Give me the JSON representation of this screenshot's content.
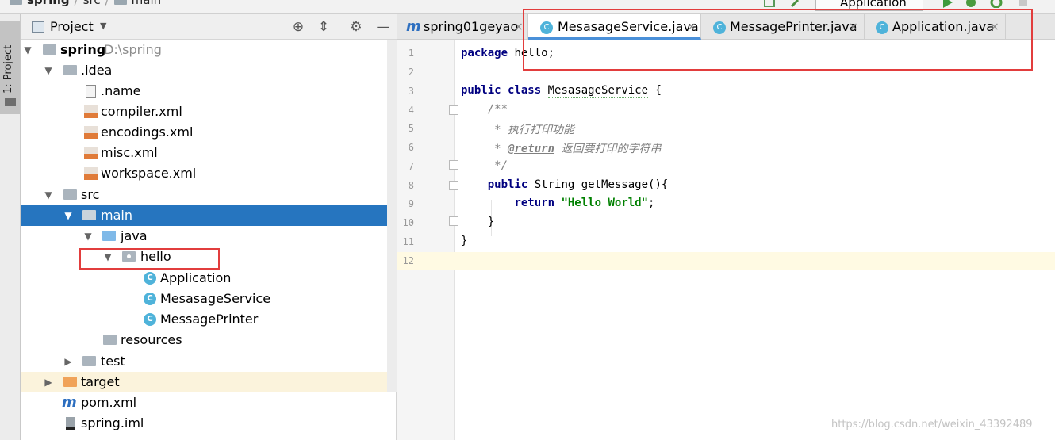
{
  "breadcrumb": {
    "root": "spring",
    "items": [
      "src",
      "main"
    ]
  },
  "toolbar": {
    "run_config": "Application"
  },
  "left_strip": {
    "label": "1: Project"
  },
  "project_panel": {
    "title": "Project",
    "tree": [
      {
        "label": "spring",
        "extra": "D:\\spring",
        "type": "folder"
      },
      {
        "label": ".idea",
        "type": "folder"
      },
      {
        "label": ".name",
        "type": "file"
      },
      {
        "label": "compiler.xml",
        "type": "xml"
      },
      {
        "label": "encodings.xml",
        "type": "xml"
      },
      {
        "label": "misc.xml",
        "type": "xml"
      },
      {
        "label": "workspace.xml",
        "type": "xml"
      },
      {
        "label": "src",
        "type": "folder"
      },
      {
        "label": "main",
        "type": "folder"
      },
      {
        "label": "java",
        "type": "folder"
      },
      {
        "label": "hello",
        "type": "package"
      },
      {
        "label": "Application",
        "type": "class"
      },
      {
        "label": "MesasageService",
        "type": "class"
      },
      {
        "label": "MessagePrinter",
        "type": "class"
      },
      {
        "label": "resources",
        "type": "folder"
      },
      {
        "label": "test",
        "type": "folder"
      },
      {
        "label": "target",
        "type": "folder"
      },
      {
        "label": "pom.xml",
        "type": "maven"
      },
      {
        "label": "spring.iml",
        "type": "iml"
      }
    ]
  },
  "editor": {
    "tabs": [
      {
        "label": "spring01geyao",
        "active": false
      },
      {
        "label": "MesasageService.java",
        "active": true
      },
      {
        "label": "MessagePrinter.java",
        "active": false
      },
      {
        "label": "Application.java",
        "active": false
      }
    ],
    "line_numbers": [
      "1",
      "2",
      "3",
      "4",
      "5",
      "6",
      "7",
      "8",
      "9",
      "10",
      "11",
      "12"
    ],
    "code": {
      "l1_kw": "package",
      "l1_rest": " hello;",
      "l3_kw1": "public",
      "l3_kw2": "class",
      "l3_name": "MesasageService",
      "l3_rest": " {",
      "l4": "/**",
      "l5": "* 执行打印功能",
      "l6_star": "* ",
      "l6_tag": "@return",
      "l6_rest": " 返回要打印的字符串",
      "l7": "*/",
      "l8_kw": "public",
      "l8_rest": " String getMessage(){",
      "l9_kw": "return",
      "l9_str": "\"Hello World\"",
      "l9_rest": ";",
      "l10": "}",
      "l11": "}"
    }
  },
  "watermark": "https://blog.csdn.net/weixin_43392489"
}
